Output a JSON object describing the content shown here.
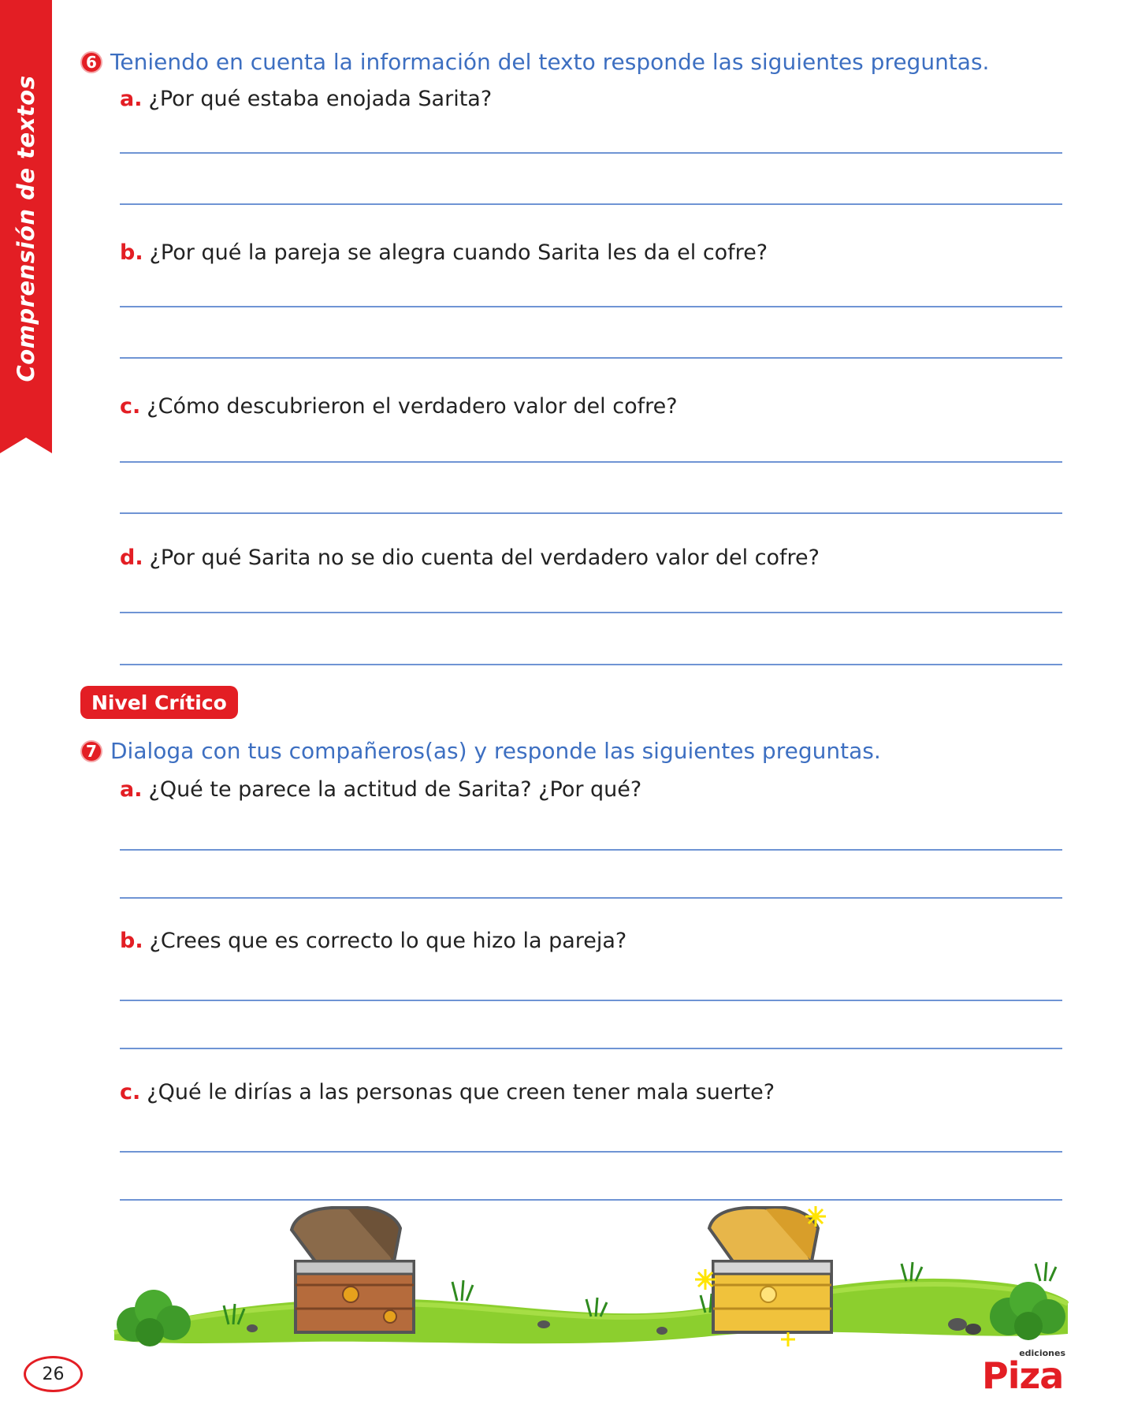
{
  "side": {
    "label": "Comprensión de textos"
  },
  "exercise6": {
    "number": "6",
    "instruction": "Teniendo en cuenta la información del texto responde las siguientes preguntas.",
    "questions": [
      {
        "letter": "a.",
        "text": "¿Por qué estaba enojada Sarita?"
      },
      {
        "letter": "b.",
        "text": "¿Por qué la pareja se alegra cuando Sarita les da el cofre?"
      },
      {
        "letter": "c.",
        "text": "¿Cómo descubrieron el verdadero valor del cofre?"
      },
      {
        "letter": "d.",
        "text": "¿Por qué Sarita no se dio cuenta del verdadero valor del cofre?"
      }
    ]
  },
  "level": {
    "label": "Nivel Crítico"
  },
  "exercise7": {
    "number": "7",
    "instruction": "Dialoga con tus compañeros(as) y responde las siguientes preguntas.",
    "questions": [
      {
        "letter": "a.",
        "text": "¿Qué te parece la actitud de Sarita? ¿Por qué?"
      },
      {
        "letter": "b.",
        "text": "¿Crees que es correcto lo que hizo la pareja?"
      },
      {
        "letter": "c.",
        "text": "¿Qué le dirías a las personas que creen tener mala suerte?"
      }
    ]
  },
  "footer": {
    "page_number": "26",
    "brand_small": "ediciones",
    "brand_name": "Piza"
  },
  "colors": {
    "accent_red": "#e31e24",
    "instruction_blue": "#3d6fc1",
    "line_blue": "#6f94d4"
  }
}
